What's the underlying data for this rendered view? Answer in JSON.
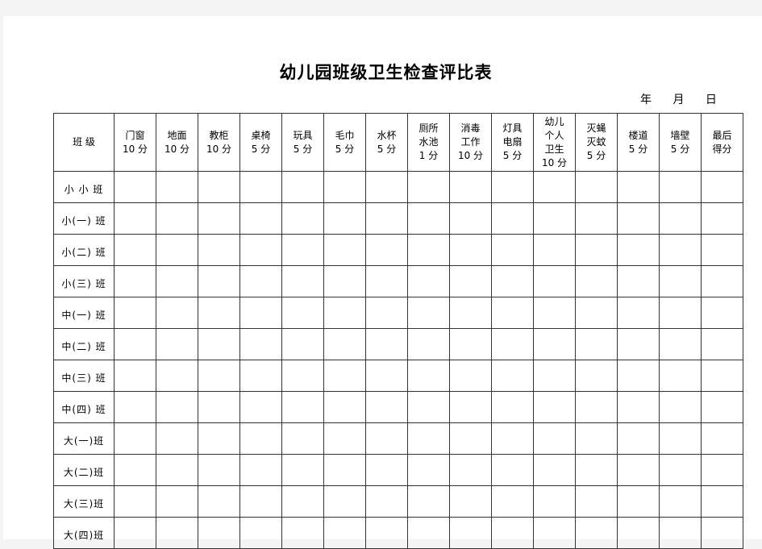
{
  "document": {
    "title": "幼儿园班级卫生检查评比表",
    "date_fields": [
      "年",
      "月",
      "日"
    ]
  },
  "table": {
    "columns": [
      {
        "lines": [
          "班  级"
        ]
      },
      {
        "lines": [
          "门窗",
          "10 分"
        ]
      },
      {
        "lines": [
          "地面",
          "10 分"
        ]
      },
      {
        "lines": [
          "教柜",
          "10 分"
        ]
      },
      {
        "lines": [
          "桌椅",
          "5 分"
        ]
      },
      {
        "lines": [
          "玩具",
          "5 分"
        ]
      },
      {
        "lines": [
          "毛巾",
          "5 分"
        ]
      },
      {
        "lines": [
          "水杯",
          "5 分"
        ]
      },
      {
        "lines": [
          "厕所",
          "水池",
          "1 分"
        ]
      },
      {
        "lines": [
          "消毒",
          "工作",
          "10 分"
        ]
      },
      {
        "lines": [
          "灯具",
          "电扇",
          "5 分"
        ]
      },
      {
        "lines": [
          "幼儿",
          "个人",
          "卫生",
          "10 分"
        ]
      },
      {
        "lines": [
          "灭蝇",
          "灭蚊",
          "5 分"
        ]
      },
      {
        "lines": [
          "楼道",
          "5 分"
        ]
      },
      {
        "lines": [
          "墙壁",
          "5 分"
        ]
      },
      {
        "lines": [
          "最后",
          "得分"
        ]
      }
    ],
    "rows": [
      {
        "label": "小 小 班"
      },
      {
        "label": "小(一) 班"
      },
      {
        "label": "小(二) 班"
      },
      {
        "label": "小(三) 班"
      },
      {
        "label": "中(一) 班"
      },
      {
        "label": "中(二) 班"
      },
      {
        "label": "中(三) 班"
      },
      {
        "label": "中(四) 班"
      },
      {
        "label": "大(一)班"
      },
      {
        "label": "大(二)班"
      },
      {
        "label": "大(三)班"
      },
      {
        "label": "大(四)班"
      }
    ]
  }
}
